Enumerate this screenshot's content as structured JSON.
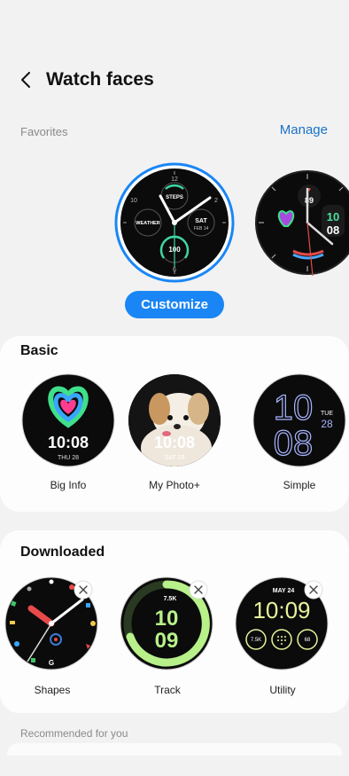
{
  "header": {
    "title": "Watch faces",
    "back_icon": "chevron-left-icon"
  },
  "favorites": {
    "label": "Favorites",
    "manage_label": "Manage",
    "customize_label": "Customize",
    "faces": [
      {
        "steps": "STEPS",
        "weather": "WEATHER",
        "day": "SAT",
        "date": "FEB 14",
        "count": "100"
      },
      {
        "temp": "89",
        "time_hour": "10",
        "time_min": "08"
      }
    ]
  },
  "basic": {
    "title": "Basic",
    "faces": [
      {
        "label": "Big Info",
        "time": "10:08",
        "date": "THU 28"
      },
      {
        "label": "My Photo+",
        "time": "10:08",
        "date": "SAT 28"
      },
      {
        "label": "Simple",
        "hour": "10",
        "min": "08",
        "day": "TUE",
        "date": "28"
      }
    ]
  },
  "downloaded": {
    "title": "Downloaded",
    "faces": [
      {
        "label": "Shapes",
        "brand": "G"
      },
      {
        "label": "Track",
        "steps": "7.5K",
        "hour": "10",
        "min": "09"
      },
      {
        "label": "Utility",
        "date": "MAY 24",
        "time": "10:09",
        "steps": "7.5K",
        "bpm": "68"
      }
    ]
  },
  "recommended": {
    "label": "Recommended for you"
  },
  "colors": {
    "accent": "#1a86f5",
    "link": "#1a73c8",
    "track_green": "#b8f08a",
    "utility_yellow": "#e8f29a"
  }
}
